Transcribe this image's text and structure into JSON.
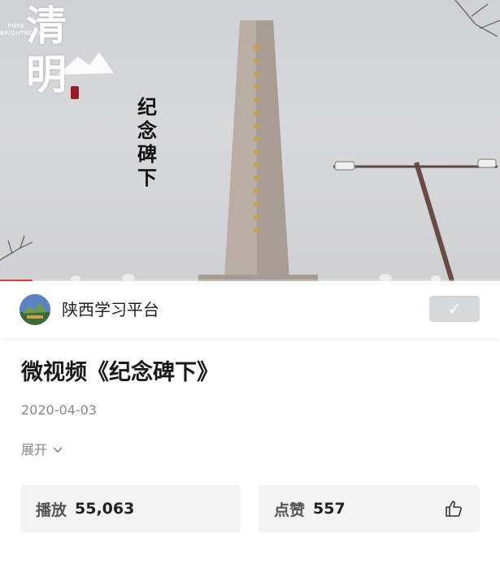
{
  "video": {
    "watermark_text": "清明",
    "brand_sub": "PURE BRIGHTNESS",
    "overlay_title": "纪念碑下",
    "progress_fraction": 0.065
  },
  "account": {
    "name": "陕西学习平台",
    "follow_icon": "✓"
  },
  "article": {
    "title": "微视频《纪念碑下》",
    "date": "2020-04-03",
    "expand_label": "展开",
    "expand_icon": "chevron-down-icon"
  },
  "stats": {
    "play_label": "播放",
    "play_count": "55,063",
    "like_label": "点赞",
    "like_count": "557",
    "like_icon": "thumbs-up-icon"
  },
  "colors": {
    "progress": "#e53935",
    "follow_bg": "#d7d8da",
    "card_bg": "#f3f3f4"
  }
}
